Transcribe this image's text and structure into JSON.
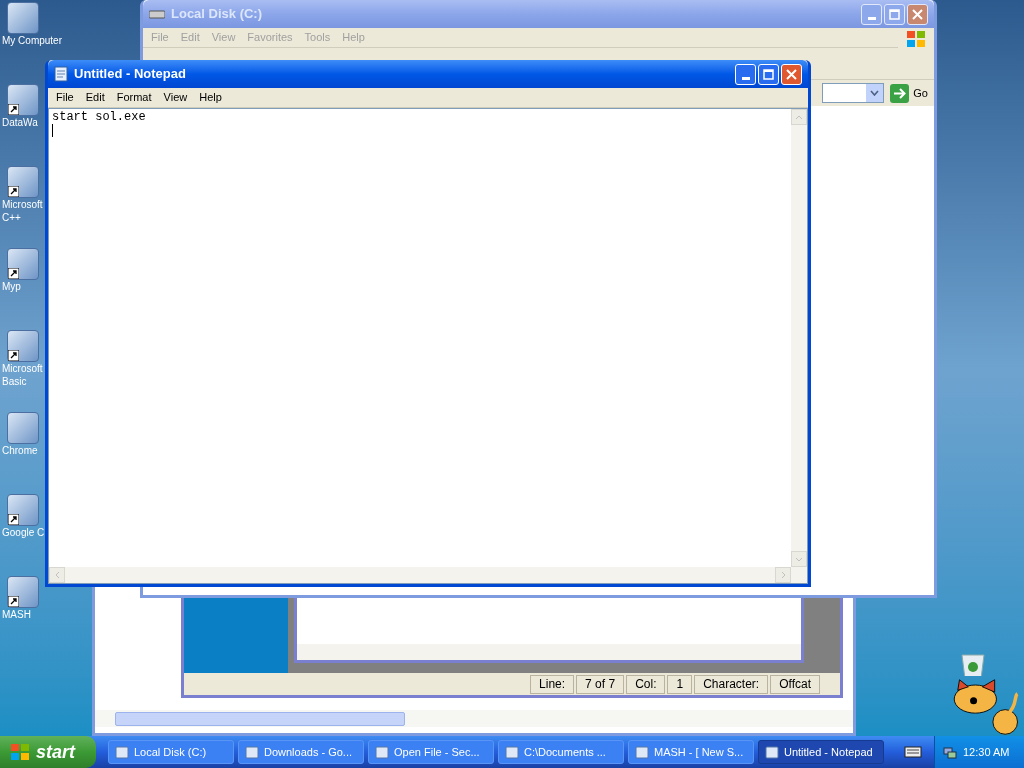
{
  "desktop_icons": [
    {
      "lines": [
        "My Computer"
      ],
      "shortcut": false
    },
    {
      "lines": [
        "DataWa"
      ],
      "shortcut": true
    },
    {
      "lines": [
        "Microsoft",
        "C++"
      ],
      "shortcut": true
    },
    {
      "lines": [
        "Myp"
      ],
      "shortcut": true
    },
    {
      "lines": [
        "Microsoft",
        "Basic"
      ],
      "shortcut": true
    },
    {
      "lines": [
        "Chrome"
      ],
      "shortcut": false
    },
    {
      "lines": [
        "Google C"
      ],
      "shortcut": true
    },
    {
      "lines": [
        "MASH"
      ],
      "shortcut": true
    }
  ],
  "explorer": {
    "title": "Local Disk (C:)",
    "active": false,
    "menu": [
      "File",
      "Edit",
      "View",
      "Favorites",
      "Tools",
      "Help"
    ],
    "go_label": "Go"
  },
  "back_window": {
    "status_bar": [
      {
        "text": "Line:"
      },
      {
        "text": "7 of 7"
      },
      {
        "text": "Col:"
      },
      {
        "text": "1"
      },
      {
        "text": "Character:"
      },
      {
        "text": "Offcat"
      }
    ]
  },
  "notepad": {
    "title": "Untitled - Notepad",
    "active": true,
    "menu": [
      "File",
      "Edit",
      "Format",
      "View",
      "Help"
    ],
    "text": "start sol.exe"
  },
  "taskbar": {
    "start_label": "start",
    "tasks": [
      {
        "label": "Local Disk (C:)",
        "selected": false
      },
      {
        "label": "Downloads - Go...",
        "selected": false
      },
      {
        "label": "Open File - Sec...",
        "selected": false
      },
      {
        "label": "C:\\Documents ...",
        "selected": false
      },
      {
        "label": "MASH - [ New S...",
        "selected": false
      },
      {
        "label": "Untitled - Notepad",
        "selected": true
      }
    ],
    "clock": "12:30 AM"
  }
}
